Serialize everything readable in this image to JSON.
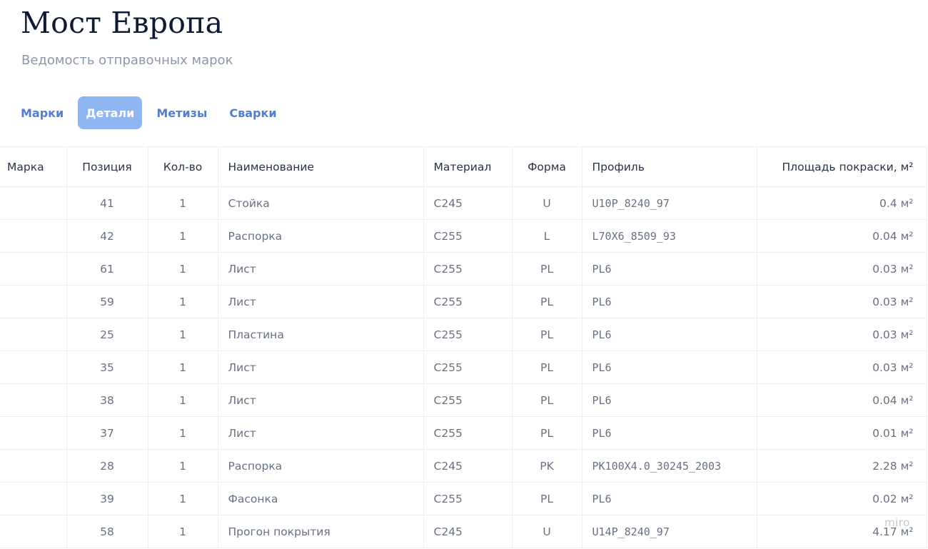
{
  "header": {
    "title": "Мост Европа",
    "subtitle": "Ведомость отправочных марок"
  },
  "tabs": [
    {
      "label": "Марки",
      "active": false
    },
    {
      "label": "Детали",
      "active": true
    },
    {
      "label": "Метизы",
      "active": false
    },
    {
      "label": "Сварки",
      "active": false
    }
  ],
  "table": {
    "columns": [
      "Марка",
      "Позиция",
      "Кол-во",
      "Наименование",
      "Материал",
      "Форма",
      "Профиль",
      "Площадь покраски, м²"
    ],
    "rows": [
      {
        "mark": "",
        "position": "41",
        "qty": "1",
        "name": "Стойка",
        "material": "C245",
        "form": "U",
        "profile": "U10P_8240_97",
        "area": "0.4 м²"
      },
      {
        "mark": "",
        "position": "42",
        "qty": "1",
        "name": "Распорка",
        "material": "C255",
        "form": "L",
        "profile": "L70X6_8509_93",
        "area": "0.04 м²"
      },
      {
        "mark": "",
        "position": "61",
        "qty": "1",
        "name": "Лист",
        "material": "C255",
        "form": "PL",
        "profile": "PL6",
        "area": "0.03 м²"
      },
      {
        "mark": "",
        "position": "59",
        "qty": "1",
        "name": "Лист",
        "material": "C255",
        "form": "PL",
        "profile": "PL6",
        "area": "0.03 м²"
      },
      {
        "mark": "",
        "position": "25",
        "qty": "1",
        "name": "Пластина",
        "material": "C255",
        "form": "PL",
        "profile": "PL6",
        "area": "0.03 м²"
      },
      {
        "mark": "",
        "position": "35",
        "qty": "1",
        "name": "Лист",
        "material": "C255",
        "form": "PL",
        "profile": "PL6",
        "area": "0.03 м²"
      },
      {
        "mark": "",
        "position": "38",
        "qty": "1",
        "name": "Лист",
        "material": "C255",
        "form": "PL",
        "profile": "PL6",
        "area": "0.04 м²"
      },
      {
        "mark": "",
        "position": "37",
        "qty": "1",
        "name": "Лист",
        "material": "C255",
        "form": "PL",
        "profile": "PL6",
        "area": "0.01 м²"
      },
      {
        "mark": "",
        "position": "28",
        "qty": "1",
        "name": "Распорка",
        "material": "C245",
        "form": "PK",
        "profile": "PK100X4.0_30245_2003",
        "area": "2.28 м²"
      },
      {
        "mark": "",
        "position": "39",
        "qty": "1",
        "name": "Фасонка",
        "material": "C255",
        "form": "PL",
        "profile": "PL6",
        "area": "0.02 м²"
      },
      {
        "mark": "",
        "position": "58",
        "qty": "1",
        "name": "Прогон покрытия",
        "material": "C245",
        "form": "U",
        "profile": "U14P_8240_97",
        "area": "4.17 м²"
      }
    ]
  },
  "watermark": "miro"
}
